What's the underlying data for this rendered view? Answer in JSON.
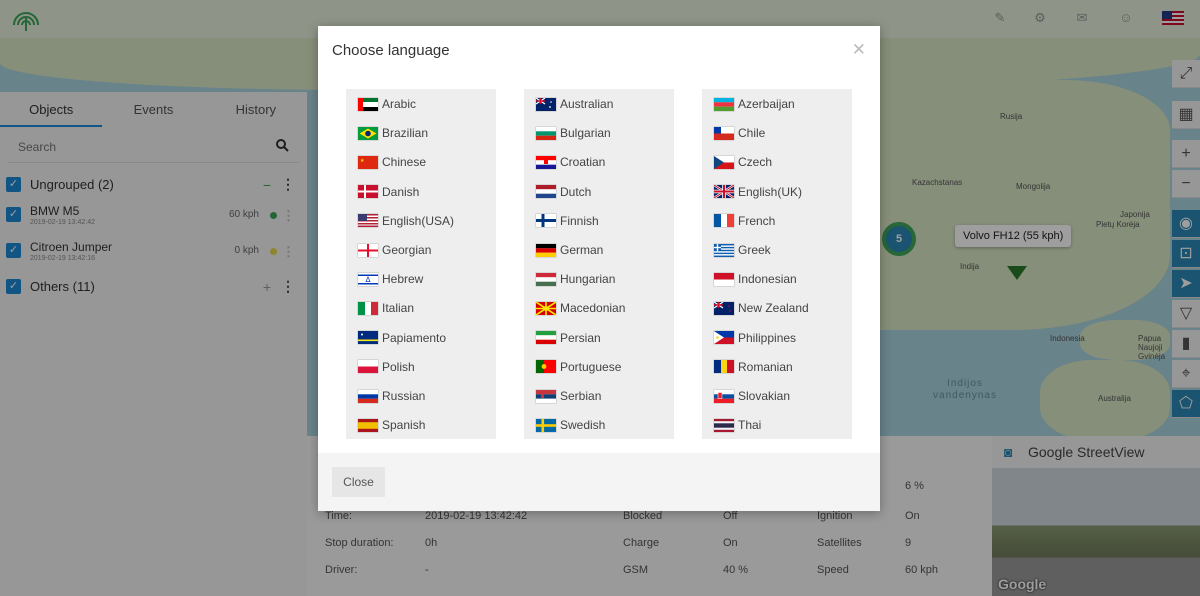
{
  "map": {
    "labels": [
      "Rusija",
      "Kazachstanas",
      "Mongolija",
      "Japonija",
      "Pietų Korėja",
      "Indija",
      "Indonesia",
      "Papua Naujoji Gvinėja",
      "Australija"
    ],
    "ocean": "Indijos vandenynas",
    "cluster_count": "5",
    "popup": "Volvo FH12 (55 kph)"
  },
  "left_panel": {
    "tabs": [
      {
        "label": "Objects",
        "active": true
      },
      {
        "label": "Events",
        "active": false
      },
      {
        "label": "History",
        "active": false
      }
    ],
    "search_placeholder": "Search",
    "groups": [
      {
        "label": "Ungrouped (2)"
      },
      {
        "label": "Others (11)"
      }
    ],
    "objects": [
      {
        "name": "BMW M5",
        "time": "2019-02-19 13:42:42",
        "speed": "60 kph",
        "status_color": "#3aa55a"
      },
      {
        "name": "Citroen Jumper",
        "time": "2019-02-19 13:42:16",
        "speed": "0 kph",
        "status_color": "#e6d84a"
      }
    ]
  },
  "bottom_panel": {
    "left_rows": [
      {
        "label": "Time:",
        "value": "2019-02-19 13:42:42"
      },
      {
        "label": "Stop duration:",
        "value": "0h"
      },
      {
        "label": "Driver:",
        "value": "-"
      }
    ],
    "mid_rows": [
      {
        "label": "Blocked",
        "value": "Off"
      },
      {
        "label": "Charge",
        "value": "On"
      },
      {
        "label": "GSM",
        "value": "40 %"
      }
    ],
    "right_rows": [
      {
        "label": "",
        "value": "6 %"
      },
      {
        "label": "Ignition",
        "value": "On"
      },
      {
        "label": "Satellites",
        "value": "9"
      },
      {
        "label": "Speed",
        "value": "60 kph"
      }
    ]
  },
  "streetview": {
    "title": "Google StreetView",
    "logo": "Google"
  },
  "modal": {
    "title": "Choose language",
    "close_button": "Close",
    "columns": [
      [
        {
          "label": "Arabic",
          "flag": "ae"
        },
        {
          "label": "Brazilian",
          "flag": "br"
        },
        {
          "label": "Chinese",
          "flag": "cn"
        },
        {
          "label": "Danish",
          "flag": "dk"
        },
        {
          "label": "English(USA)",
          "flag": "us"
        },
        {
          "label": "Georgian",
          "flag": "ge"
        },
        {
          "label": "Hebrew",
          "flag": "il"
        },
        {
          "label": "Italian",
          "flag": "it"
        },
        {
          "label": "Papiamento",
          "flag": "cw"
        },
        {
          "label": "Polish",
          "flag": "pl"
        },
        {
          "label": "Russian",
          "flag": "ru"
        },
        {
          "label": "Spanish",
          "flag": "es"
        }
      ],
      [
        {
          "label": "Australian",
          "flag": "au"
        },
        {
          "label": "Bulgarian",
          "flag": "bg"
        },
        {
          "label": "Croatian",
          "flag": "hr"
        },
        {
          "label": "Dutch",
          "flag": "nl"
        },
        {
          "label": "Finnish",
          "flag": "fi"
        },
        {
          "label": "German",
          "flag": "de"
        },
        {
          "label": "Hungarian",
          "flag": "hu"
        },
        {
          "label": "Macedonian",
          "flag": "mk"
        },
        {
          "label": "Persian",
          "flag": "ir"
        },
        {
          "label": "Portuguese",
          "flag": "pt"
        },
        {
          "label": "Serbian",
          "flag": "rs"
        },
        {
          "label": "Swedish",
          "flag": "se"
        }
      ],
      [
        {
          "label": "Azerbaijan",
          "flag": "az"
        },
        {
          "label": "Chile",
          "flag": "cl"
        },
        {
          "label": "Czech",
          "flag": "cz"
        },
        {
          "label": "English(UK)",
          "flag": "gb"
        },
        {
          "label": "French",
          "flag": "fr"
        },
        {
          "label": "Greek",
          "flag": "gr"
        },
        {
          "label": "Indonesian",
          "flag": "id"
        },
        {
          "label": "New Zealand",
          "flag": "nz"
        },
        {
          "label": "Philippines",
          "flag": "ph"
        },
        {
          "label": "Romanian",
          "flag": "ro"
        },
        {
          "label": "Slovakian",
          "flag": "sk"
        },
        {
          "label": "Thai",
          "flag": "th"
        }
      ]
    ]
  }
}
